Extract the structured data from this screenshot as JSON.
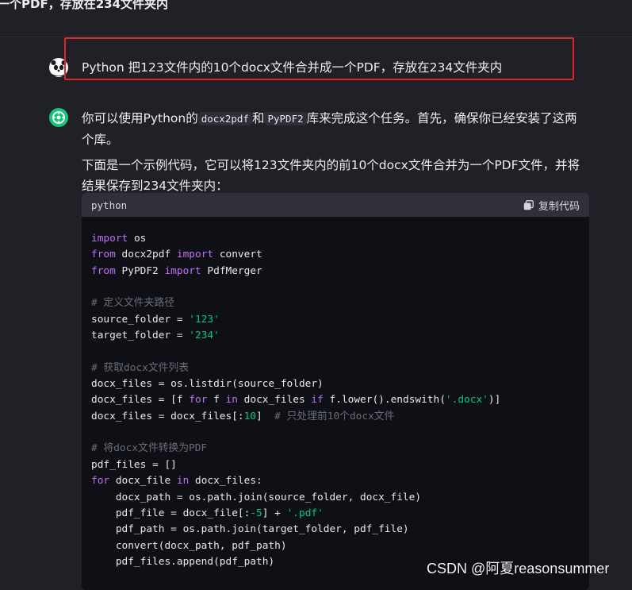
{
  "header": {
    "title": "一个PDF，存放在234文件夹内"
  },
  "user_message": {
    "text": "Python 把123文件内的10个docx文件合并成一个PDF，存放在234文件夹内"
  },
  "assistant_message": {
    "p1_a": "你可以使用Python的",
    "p1_code1": "docx2pdf",
    "p1_b": "和",
    "p1_code2": "PyPDF2",
    "p1_c": "库来完成这个任务。首先，确保你已经安装了这两个库。",
    "p2": "下面是一个示例代码，它可以将123文件夹内的前10个docx文件合并为一个PDF文件，并将结果保存到234文件夹内："
  },
  "code_block": {
    "language": "python",
    "copy_label": "复制代码",
    "lines": {
      "l1_kw": "import",
      "l1_rest": " os",
      "l2_kw1": "from",
      "l2_mid": " docx2pdf ",
      "l2_kw2": "import",
      "l2_rest": " convert",
      "l3_kw1": "from",
      "l3_mid": " PyPDF2 ",
      "l3_kw2": "import",
      "l3_rest": " PdfMerger",
      "c1": "# 定义文件夹路径",
      "l5_a": "source_folder = ",
      "l5_str": "'123'",
      "l6_a": "target_folder = ",
      "l6_str": "'234'",
      "c2": "# 获取docx文件列表",
      "l8": "docx_files = os.listdir(source_folder)",
      "l9_a": "docx_files = [f ",
      "l9_kw1": "for",
      "l9_b": " f ",
      "l9_kw2": "in",
      "l9_c": " docx_files ",
      "l9_kw3": "if",
      "l9_d": " f.lower().endswith(",
      "l9_str": "'.docx'",
      "l9_e": ")]",
      "l10_a": "docx_files = docx_files[:",
      "l10_num": "10",
      "l10_b": "]  ",
      "l10_cm": "# 只处理前10个docx文件",
      "c3": "# 将docx文件转换为PDF",
      "l12": "pdf_files = []",
      "l13_kw1": "for",
      "l13_a": " docx_file ",
      "l13_kw2": "in",
      "l13_b": " docx_files:",
      "l14": "    docx_path = os.path.join(source_folder, docx_file)",
      "l15_a": "    pdf_file = docx_file[:",
      "l15_num": "-5",
      "l15_b": "] + ",
      "l15_str": "'.pdf'",
      "l16": "    pdf_path = os.path.join(target_folder, pdf_file)",
      "l17": "    convert(docx_path, pdf_path)",
      "l18": "    pdf_files.append(pdf_path)"
    }
  },
  "watermark": {
    "text": "CSDN @阿夏reasonsummer"
  },
  "colors": {
    "background": "#202127",
    "highlight": "#e0262b",
    "keyword": "#c26ef5",
    "string": "#07c58e",
    "bot_avatar": "#19c37d"
  }
}
